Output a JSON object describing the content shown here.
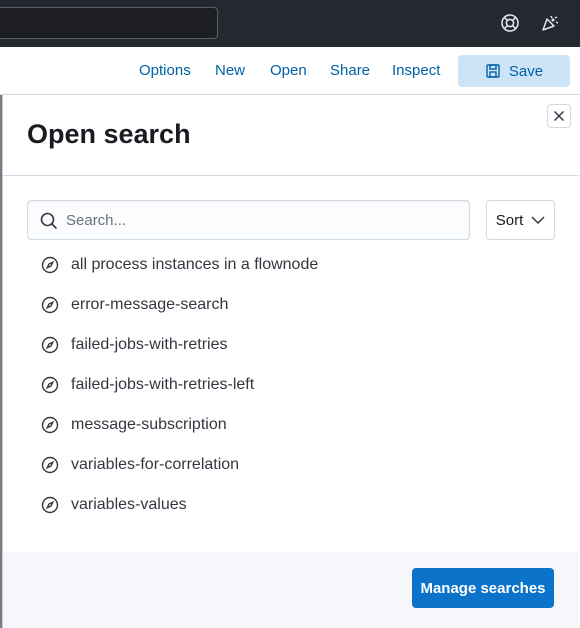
{
  "topbar": {
    "help_icon": "lifebuoy-icon",
    "news_icon": "newsfeed-icon"
  },
  "toolbar": {
    "options_label": "Options",
    "new_label": "New",
    "open_label": "Open",
    "share_label": "Share",
    "inspect_label": "Inspect",
    "save_label": "Save"
  },
  "flyout": {
    "title": "Open search",
    "search": {
      "placeholder": "Search...",
      "value": ""
    },
    "sort_label": "Sort",
    "saved_searches": [
      {
        "label": "all process instances in a flownode"
      },
      {
        "label": "error-message-search"
      },
      {
        "label": "failed-jobs-with-retries"
      },
      {
        "label": "failed-jobs-with-retries-left"
      },
      {
        "label": "message-subscription"
      },
      {
        "label": "variables-for-correlation"
      },
      {
        "label": "variables-values"
      }
    ],
    "manage_label": "Manage searches"
  },
  "colors": {
    "topbar_bg": "#25282f",
    "link": "#0061a6",
    "save_bg": "#cce4f5",
    "primary_button": "#0b73c9",
    "footer_bg": "#f5f7fa"
  }
}
